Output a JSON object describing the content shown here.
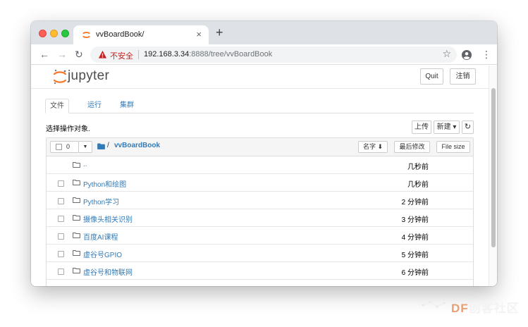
{
  "browser": {
    "tab_title": "vvBoardBook/",
    "tab_close": "×",
    "new_tab": "+",
    "nav": {
      "back": "←",
      "forward": "→",
      "reload": "↻"
    },
    "security_label": "不安全",
    "url_host": "192.168.3.34",
    "url_rest": ":8888/tree/vvBoardBook",
    "star": "☆",
    "menu": "⋮"
  },
  "header": {
    "logo_text": "jupyter",
    "quit_label": "Quit",
    "logout_label": "注销"
  },
  "tabs": [
    {
      "label": "文件"
    },
    {
      "label": "运行"
    },
    {
      "label": "集群"
    }
  ],
  "toolbar": {
    "select_text": "选择操作对象.",
    "upload_label": "上传",
    "new_label": "新建 ▾",
    "refresh_icon": "↻"
  },
  "list_header": {
    "selected_count": "0",
    "dropdown": "▼",
    "breadcrumb_sep": "/",
    "breadcrumb_folder": "vvBoardBook",
    "sort_name": "名字 ⬇",
    "sort_modified": "最后修改",
    "sort_size": "File size"
  },
  "rows": [
    {
      "name": "..",
      "time": "几秒前",
      "checkbox": false
    },
    {
      "name": "Python和绘图",
      "time": "几秒前",
      "checkbox": true
    },
    {
      "name": "Python学习",
      "time": "2 分钟前",
      "checkbox": true
    },
    {
      "name": "摄像头相关识别",
      "time": "3 分钟前",
      "checkbox": true
    },
    {
      "name": "百度AI课程",
      "time": "4 分钟前",
      "checkbox": true
    },
    {
      "name": "虚谷号GPIO",
      "time": "5 分钟前",
      "checkbox": true
    },
    {
      "name": "虚谷号和物联网",
      "time": "6 分钟前",
      "checkbox": true
    }
  ],
  "watermark": {
    "prefix": "DF",
    "suffix": "创客社区"
  },
  "colors": {
    "link": "#337ab7",
    "insecure": "#c5221f",
    "jupyter_orange": "#f37726"
  }
}
